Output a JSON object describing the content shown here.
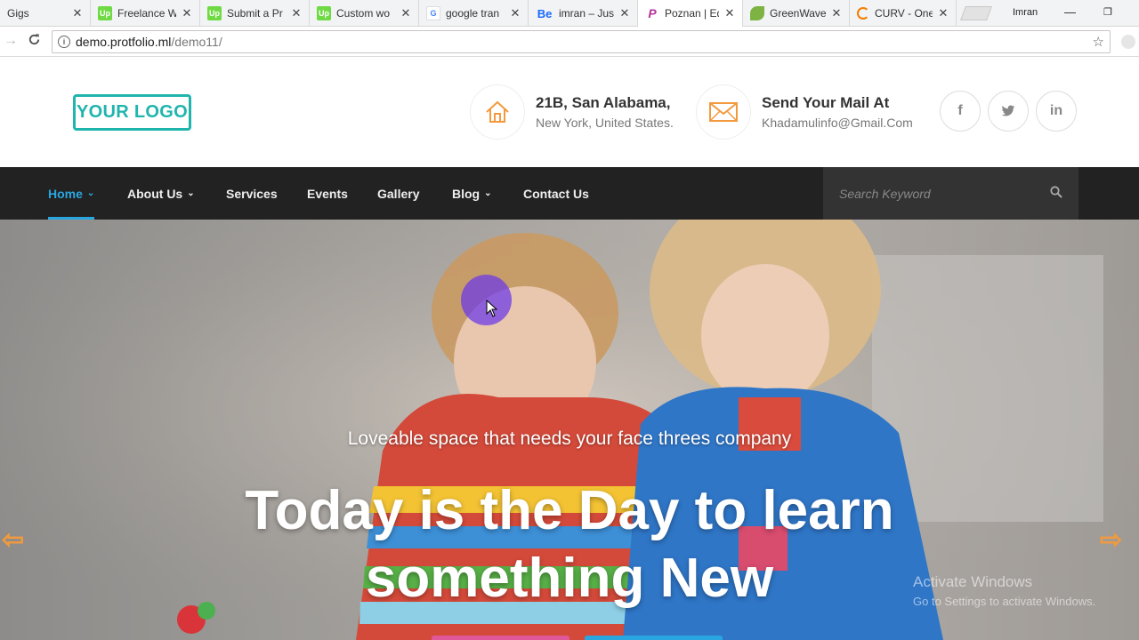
{
  "browser": {
    "tabs": [
      {
        "label": "Gigs",
        "favicon": "fiverr-icon",
        "color": "#1dbf73"
      },
      {
        "label": "Freelance W",
        "favicon": "upwork-icon",
        "color": "#6fda44"
      },
      {
        "label": "Submit a Pr",
        "favicon": "upwork-icon",
        "color": "#6fda44"
      },
      {
        "label": "Custom wo",
        "favicon": "upwork-icon",
        "color": "#6fda44"
      },
      {
        "label": "google tran",
        "favicon": "google-icon",
        "color": "#4285f4"
      },
      {
        "label": "imran – Jus",
        "favicon": "behance-icon",
        "color": "#1769ff"
      },
      {
        "label": "Poznan | Ed",
        "favicon": "p-icon",
        "color": "#b4339a"
      },
      {
        "label": "GreenWave",
        "favicon": "leaf-icon",
        "color": "#7cb342"
      },
      {
        "label": "CURV - One",
        "favicon": "loading-icon",
        "color": "#f57c00"
      }
    ],
    "user": "Imran",
    "url_host": "demo.protfolio.ml",
    "url_path": "/demo11/"
  },
  "header": {
    "logo_text": "YOUR LOGO",
    "address_title": "21B, San Alabama,",
    "address_sub": "New York, United States.",
    "mail_title": "Send Your Mail At",
    "mail_sub": "Khadamulinfo@Gmail.Com",
    "social": [
      "f",
      "twitter",
      "in"
    ]
  },
  "nav": {
    "items": [
      {
        "label": "Home",
        "has_dropdown": true
      },
      {
        "label": "About Us",
        "has_dropdown": true
      },
      {
        "label": "Services",
        "has_dropdown": false
      },
      {
        "label": "Events",
        "has_dropdown": false
      },
      {
        "label": "Gallery",
        "has_dropdown": false
      },
      {
        "label": "Blog",
        "has_dropdown": true
      },
      {
        "label": "Contact Us",
        "has_dropdown": false
      }
    ],
    "search_placeholder": "Search Keyword"
  },
  "hero": {
    "subtitle": "Loveable space that needs your face threes company",
    "title_line1": "Today is the Day to learn",
    "title_line2": "something New",
    "watermark_line1": "Activate Windows",
    "watermark_line2": "Go to Settings to activate Windows."
  },
  "colors": {
    "accent": "#29a6e0",
    "logo": "#1fb5ad",
    "arrow": "#f29a3d",
    "nav_bg": "#222222"
  }
}
